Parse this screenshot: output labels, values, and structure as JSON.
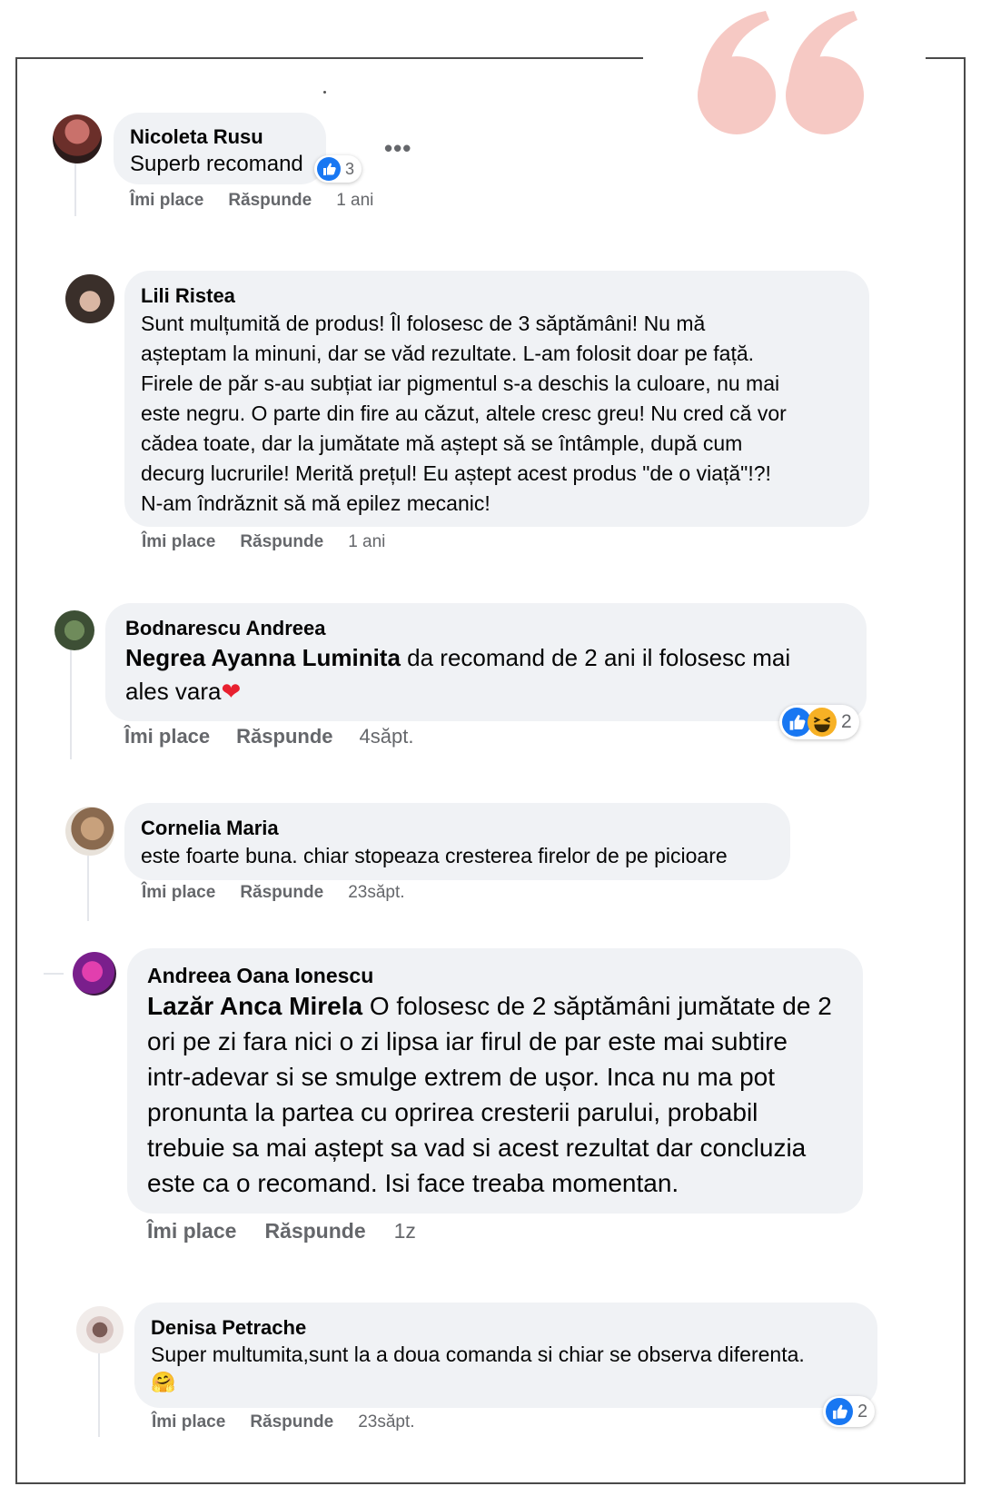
{
  "comments": [
    {
      "author": "Nicoleta Rusu",
      "text": "Superb recomand",
      "reaction_count": "3",
      "like": "Îmi place",
      "reply": "Răspunde",
      "time": "1 ani"
    },
    {
      "author": "Lili Ristea",
      "lines": [
        "Sunt mulțumită de produs! Îl folosesc de 3 săptămâni! Nu mă",
        "așteptam la minuni, dar se văd rezultate. L-am folosit doar pe față.",
        "Firele de păr s-au subțiat iar pigmentul s-a deschis la culoare, nu mai",
        "este negru. O parte din fire au căzut, altele cresc greu! Nu cred că vor",
        "cădea toate, dar la jumătate mă aștept să se întâmple, după cum",
        "decurg lucrurile! Merită prețul! Eu aștept acest produs \"de o viață\"!?!",
        "N-am îndrăznit să mă epilez mecanic!"
      ],
      "like": "Îmi place",
      "reply": "Răspunde",
      "time": "1 ani"
    },
    {
      "author": "Bodnarescu Andreea",
      "mention": "Negrea Ayanna Luminita",
      "line1_rest": " da recomand de 2 ani il folosesc mai",
      "line2": "ales vara",
      "emoji": "❤",
      "reaction_count": "2",
      "like": "Îmi place",
      "reply": "Răspunde",
      "time": "4săpt."
    },
    {
      "author": "Cornelia Maria",
      "text": "este foarte buna. chiar stopeaza cresterea firelor de pe picioare",
      "like": "Îmi place",
      "reply": "Răspunde",
      "time": "23săpt."
    },
    {
      "author": "Andreea Oana Ionescu",
      "mention": "Lazăr Anca Mirela",
      "line1_rest": " O folosesc de 2 săptămâni jumătate de 2",
      "lines": [
        "ori pe zi fara nici o zi lipsa iar firul de par este mai subtire",
        "intr-adevar si se smulge extrem de ușor. Inca nu ma pot",
        "pronunta la partea cu oprirea cresterii parului, probabil",
        "trebuie sa mai aștept sa vad si acest rezultat dar concluzia",
        "este ca o recomand. Isi face treaba momentan."
      ],
      "like": "Îmi place",
      "reply": "Răspunde",
      "time": "1z"
    },
    {
      "author": "Denisa Petrache",
      "text": "Super multumita,sunt la a doua comanda si chiar se observa diferenta.",
      "emoji": "🤗",
      "reaction_count": "2",
      "like": "Îmi place",
      "reply": "Răspunde",
      "time": "23săpt."
    }
  ],
  "colors": {
    "bubble": "#f0f2f5",
    "meta_text": "#65676b",
    "like_blue": "#1877f2",
    "quote_pink": "#f6c9c4"
  }
}
